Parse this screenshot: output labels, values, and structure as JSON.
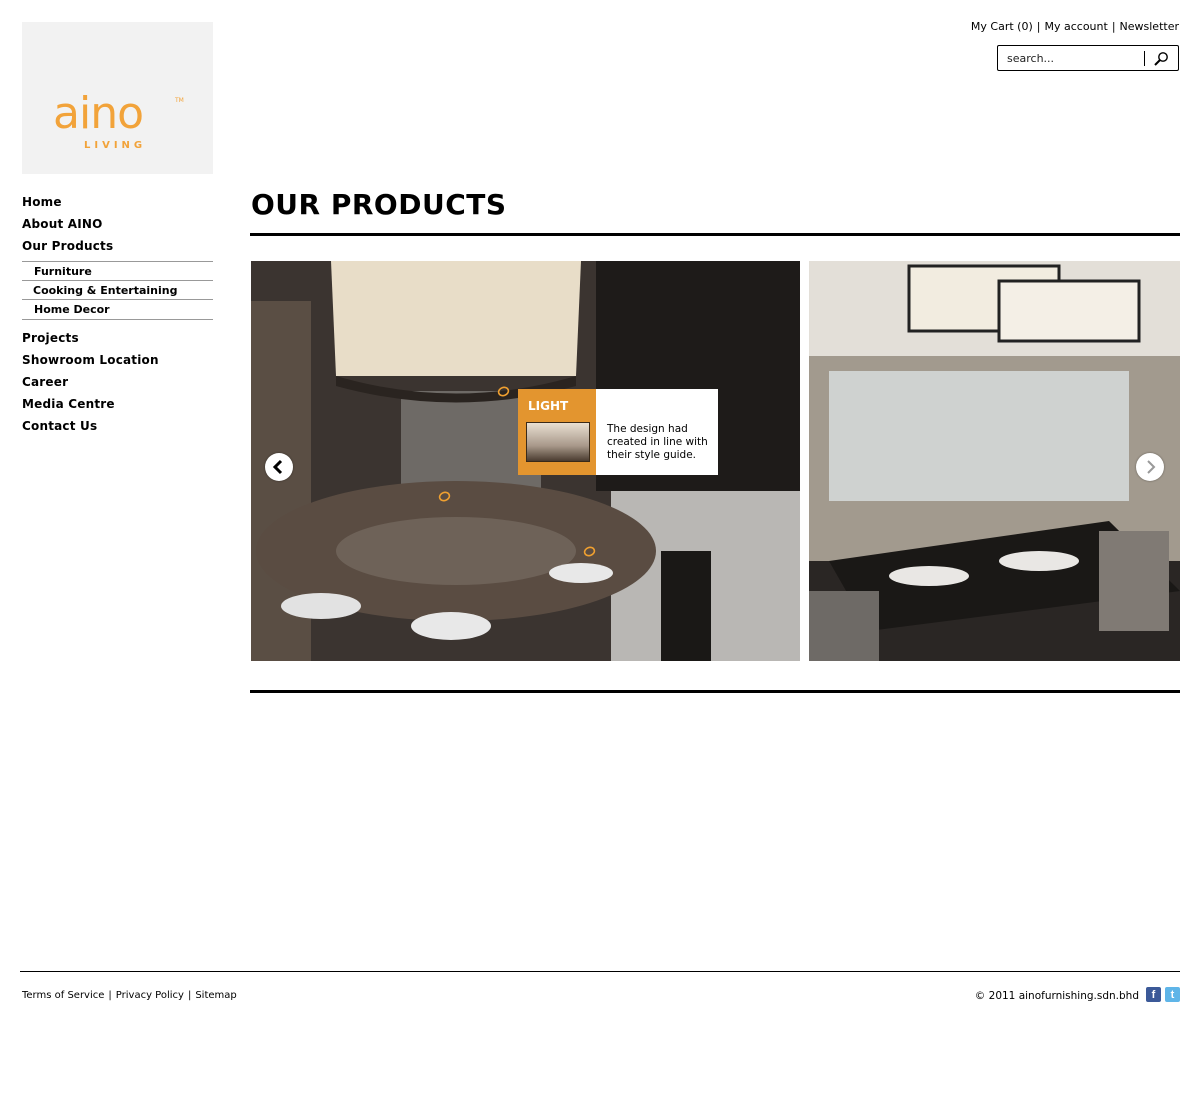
{
  "brand": {
    "logo_word": "aino",
    "logo_tm": "TM",
    "logo_sub": "LIVING",
    "accent_color": "#f2a33a"
  },
  "header": {
    "cart_label": "My Cart (0)",
    "account_label": "My account",
    "newsletter_label": "Newsletter",
    "separator": "|",
    "search_placeholder": "search...",
    "search_icon": "search-icon"
  },
  "sidebar": {
    "items": [
      {
        "label": "Home"
      },
      {
        "label": "About AINO"
      },
      {
        "label": "Our Products"
      }
    ],
    "subitems": [
      {
        "label": "Furniture"
      },
      {
        "label": "Cooking & Entertaining"
      },
      {
        "label": "Home Decor"
      }
    ],
    "items_after": [
      {
        "label": "Projects"
      },
      {
        "label": "Showroom Location"
      },
      {
        "label": "Career"
      },
      {
        "label": "Media Centre"
      },
      {
        "label": "Contact Us"
      }
    ]
  },
  "main": {
    "title": "OUR PRODUCTS",
    "slider": {
      "prev_icon": "chevron-left-icon",
      "next_icon": "chevron-right-icon",
      "popup": {
        "title": "LIGHT",
        "description": "The design had created in line with their style guide."
      }
    }
  },
  "footer": {
    "terms_label": "Terms of Service",
    "privacy_label": "Privacy Policy",
    "sitemap_label": "Sitemap",
    "separator": "|",
    "copyright": "© 2011 ainofurnishing.sdn.bhd",
    "facebook_glyph": "f",
    "twitter_glyph": "t"
  }
}
